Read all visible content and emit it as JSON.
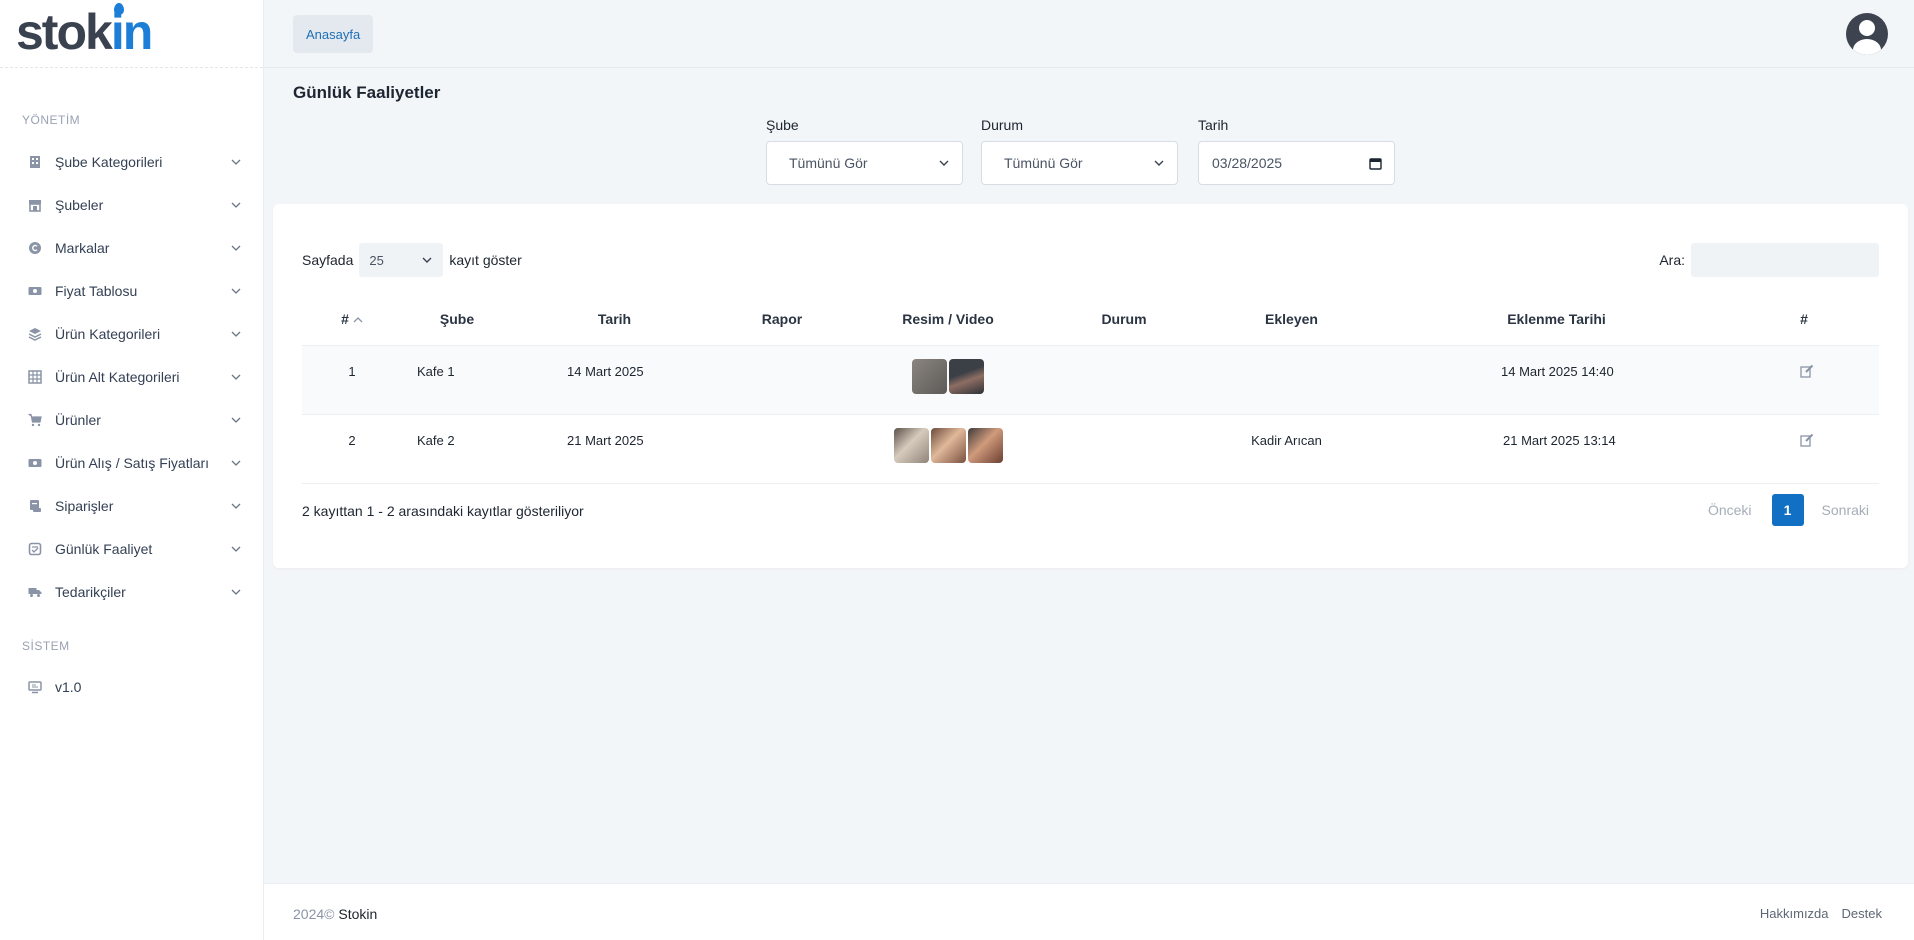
{
  "brand": {
    "part1": "stok",
    "part2": "i",
    "part3": "n"
  },
  "sidebar": {
    "section_admin": "YÖNETİM",
    "section_system": "SİSTEM",
    "items": [
      {
        "label": "Şube Kategorileri",
        "icon": "building-icon"
      },
      {
        "label": "Şubeler",
        "icon": "store-icon"
      },
      {
        "label": "Markalar",
        "icon": "copyright-icon"
      },
      {
        "label": "Fiyat Tablosu",
        "icon": "money-icon"
      },
      {
        "label": "Ürün Kategorileri",
        "icon": "layers-icon"
      },
      {
        "label": "Ürün Alt Kategorileri",
        "icon": "grid-icon"
      },
      {
        "label": "Ürünler",
        "icon": "cart-icon"
      },
      {
        "label": "Ürün Alış / Satış Fiyatları",
        "icon": "money-icon"
      },
      {
        "label": "Siparişler",
        "icon": "scroll-icon"
      },
      {
        "label": "Günlük Faaliyet",
        "icon": "clipboard-icon"
      },
      {
        "label": "Tedarikçiler",
        "icon": "truck-icon"
      }
    ],
    "system_items": [
      {
        "label": "v1.0",
        "icon": "monitor-icon"
      }
    ]
  },
  "header": {
    "breadcrumb": "Anasayfa"
  },
  "page": {
    "title": "Günlük Faaliyetler",
    "filters": {
      "sube_label": "Şube",
      "sube_value": "Tümünü Gör",
      "durum_label": "Durum",
      "durum_value": "Tümünü Gör",
      "tarih_label": "Tarih",
      "tarih_value": "03/28/2025"
    }
  },
  "table": {
    "length_prefix": "Sayfada",
    "length_value": "25",
    "length_suffix": "kayıt göster",
    "search_label": "Ara:",
    "columns": [
      "#",
      "Şube",
      "Tarih",
      "Rapor",
      "Resim / Video",
      "Durum",
      "Ekleyen",
      "Eklenme Tarihi",
      "#"
    ],
    "rows": [
      {
        "no": "1",
        "sube": "Kafe 1",
        "tarih": "14 Mart 2025",
        "rapor": "",
        "durum": "",
        "ekleyen": "",
        "eklenme": "14 Mart 2025 14:40",
        "thumbs": 2
      },
      {
        "no": "2",
        "sube": "Kafe 2",
        "tarih": "21 Mart 2025",
        "rapor": "",
        "durum": "",
        "ekleyen": "Kadir Arıcan",
        "eklenme": "21 Mart 2025 13:14",
        "thumbs": 3
      }
    ],
    "info": "2 kayıttan 1 - 2 arasındaki kayıtlar gösteriliyor",
    "pager": {
      "prev": "Önceki",
      "current": "1",
      "next": "Sonraki"
    }
  },
  "footer": {
    "year": "2024©",
    "company": "Stokin",
    "links": [
      "Hakkımızda",
      "Destek"
    ]
  },
  "colors": {
    "accent": "#1170c4",
    "brand_dark": "#3a4250",
    "brand_blue": "#1c7ed6"
  }
}
